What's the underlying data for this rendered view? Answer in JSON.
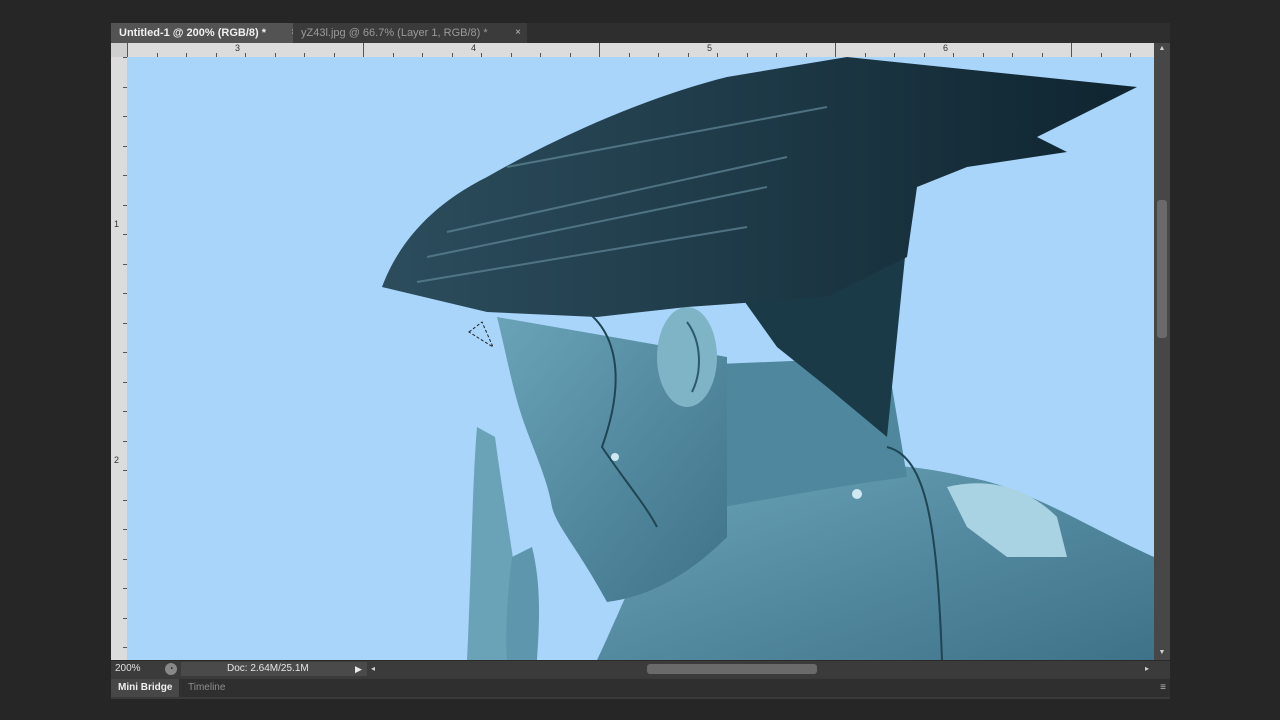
{
  "tabs": [
    {
      "label": "Untitled-1 @ 200% (RGB/8) *",
      "active": true
    },
    {
      "label": "yZ43l.jpg @ 66.7% (Layer 1, RGB/8) *",
      "active": false
    }
  ],
  "tab_close_glyph": "×",
  "ruler": {
    "top_labels": [
      "3",
      "4",
      "5",
      "6"
    ],
    "left_labels": [
      "1",
      "2"
    ]
  },
  "canvas": {
    "background": "#a9d5fb",
    "subject_color": "#2f5a6b",
    "description_icon": "cyborg-woman-artwork"
  },
  "status": {
    "zoom": "200%",
    "doc_info": "Doc: 2.64M/25.1M"
  },
  "panel_tabs": [
    "Mini Bridge",
    "Timeline"
  ],
  "icons": {
    "scroll_up": "▲",
    "scroll_down": "▼",
    "scroll_left": "◂",
    "scroll_right": "▸",
    "doc_menu_arrow": "▶",
    "panel_menu": "≡"
  }
}
